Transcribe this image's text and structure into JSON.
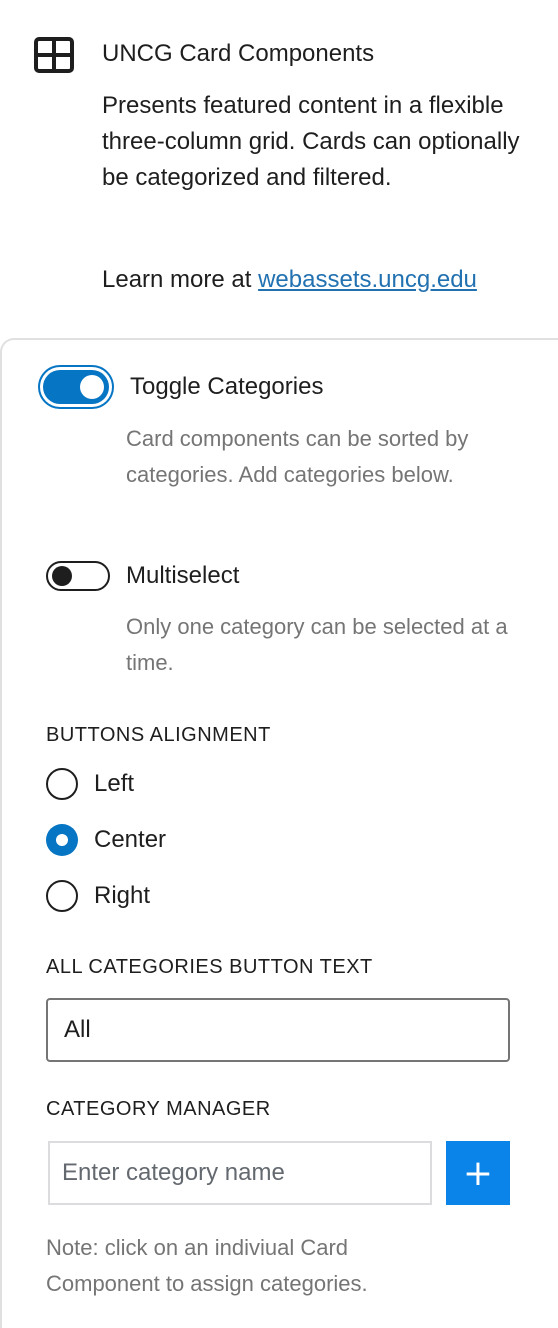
{
  "block": {
    "icon": "grid-icon",
    "title": "UNCG Card Components",
    "description": "Presents featured content in a flexible three-column grid. Cards can optionally be categorized and filtered.",
    "learn_more_prefix": "Learn more at ",
    "learn_more_link": "webassets.uncg.edu"
  },
  "colors": {
    "accent": "#0675c4",
    "button": "#0a84e8",
    "link": "#2271b1",
    "help_text": "#757575"
  },
  "settings": {
    "toggle_categories": {
      "label": "Toggle Categories",
      "checked": true,
      "help": "Card components can be sorted by categories. Add categories below."
    },
    "multiselect": {
      "label": "Multiselect",
      "checked": false,
      "help": "Only one category can be selected at a time."
    },
    "buttons_alignment": {
      "label": "Buttons Alignment",
      "options": [
        "Left",
        "Center",
        "Right"
      ],
      "selected": "Center"
    },
    "all_categories_button_text": {
      "label": "All Categories Button Text",
      "value": "All"
    },
    "category_manager": {
      "label": "Category Manager",
      "placeholder": "Enter category name",
      "add_label": "+"
    },
    "note": "Note: click on an indiviual Card Component to assign categories."
  }
}
